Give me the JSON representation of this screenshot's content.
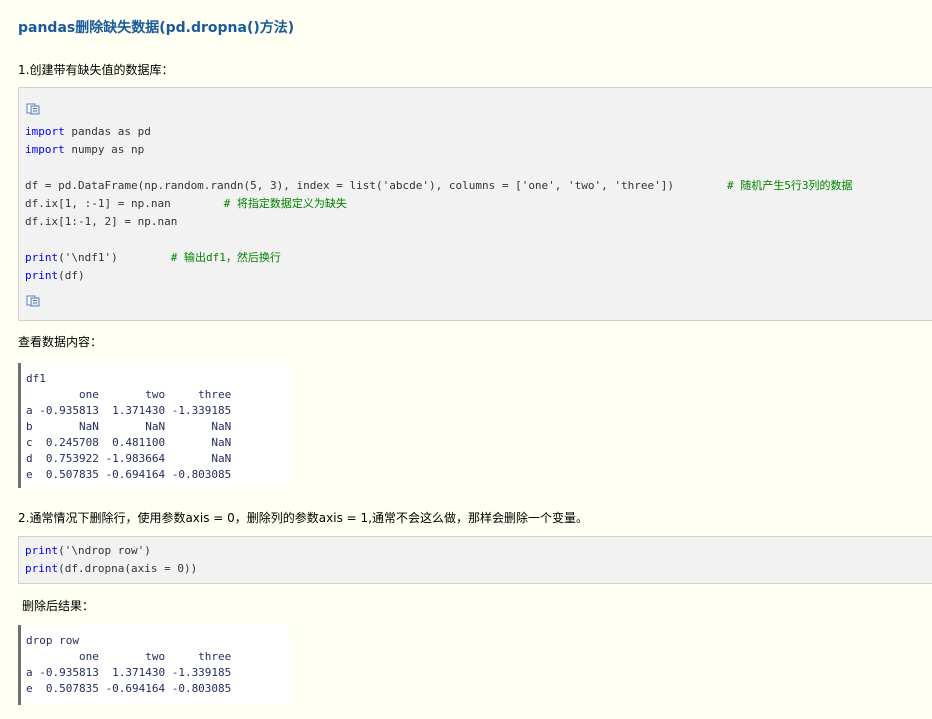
{
  "title": "pandas删除缺失数据(pd.dropna()方法)",
  "step1": "1.创建带有缺失值的数据库：",
  "code1": {
    "line1_kw": "import",
    "line1_rest": " pandas as pd",
    "line2_kw": "import",
    "line2_rest": " numpy as np",
    "line3_code": "df = pd.DataFrame(np.random.randn(5, 3), index = list('abcde'), columns = ['one', 'two', 'three'])        ",
    "line3_comment": "# 随机产生5行3列的数据",
    "line4_code": "df.ix[1, :-1] = np.nan        ",
    "line4_comment": "# 将指定数据定义为缺失",
    "line5_code": "df.ix[1:-1, 2] = np.nan",
    "line6_kw": "print",
    "line6_rest": "('\\ndf1')        ",
    "line6_comment": "# 输出df1，然后换行",
    "line7_kw": "print",
    "line7_rest": "(df)"
  },
  "view_label": "查看数据内容：",
  "output1": {
    "lines": [
      "df1",
      "        one       two     three",
      "a -0.935813  1.371430 -1.339185",
      "b       NaN       NaN       NaN",
      "c  0.245708  0.481100       NaN",
      "d  0.753922 -1.983664       NaN",
      "e  0.507835 -0.694164 -0.803085"
    ]
  },
  "step2": "2.通常情况下删除行，使用参数axis = 0，删除列的参数axis = 1,通常不会这么做，那样会删除一个变量。",
  "code2": {
    "line1_kw": "print",
    "line1_rest": "('\\ndrop row')",
    "line2_kw": "print",
    "line2_rest": "(df.dropna(axis = 0))"
  },
  "result_label": "删除后结果：",
  "output2": {
    "lines": [
      "drop row",
      "        one       two     three",
      "a -0.935813  1.371430 -1.339185",
      "e  0.507835 -0.694164 -0.803085"
    ]
  },
  "icons": {
    "copy": "copy-code-icon"
  },
  "colors": {
    "title": "#1a5b9c",
    "keyword": "#0000ff",
    "comment": "#008200",
    "output_text": "#1f2a5a"
  }
}
